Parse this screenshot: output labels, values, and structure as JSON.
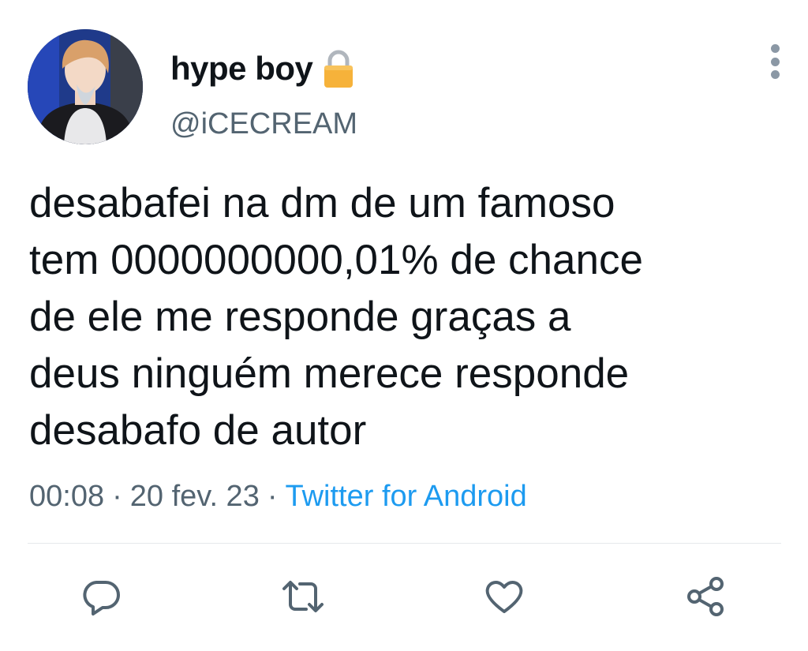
{
  "author": {
    "display_name": "hype boy",
    "handle": "@iCECREAM",
    "protected_icon": "lock-icon"
  },
  "tweet": {
    "lines": [
      "desabafei na dm de um famoso",
      "tem 0000000000,01% de chance",
      "de ele me responde graças a",
      "deus ninguém merece responde",
      "desabafo de autor"
    ],
    "time": "00:08",
    "date": "20 fev. 23",
    "separator": "·",
    "source": "Twitter for Android"
  },
  "actions": {
    "reply_icon": "reply-icon",
    "retweet_icon": "retweet-icon",
    "like_icon": "heart-icon",
    "share_icon": "share-icon"
  },
  "colors": {
    "text": "#0f1419",
    "secondary": "#536471",
    "link": "#1d9bf0",
    "icon": "#536471"
  }
}
